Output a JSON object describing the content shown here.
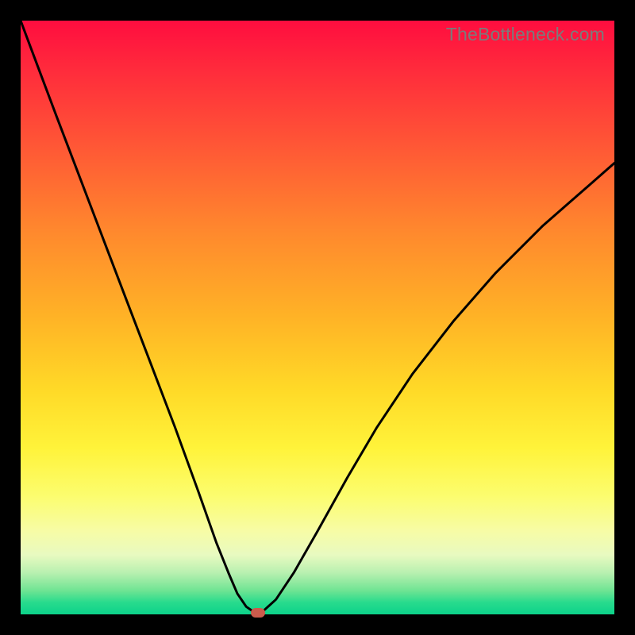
{
  "watermark_text": "TheBottleneck.com",
  "colors": {
    "frame_bg": "#000000",
    "curve_stroke": "#000000",
    "marker_fill": "#cb5b4c",
    "gradient_top": "#ff0d3f",
    "gradient_bottom": "#0cd28a"
  },
  "chart_data": {
    "type": "line",
    "title": "",
    "xlabel": "",
    "ylabel": "",
    "xlim": [
      0,
      100
    ],
    "ylim": [
      0,
      100
    ],
    "grid": false,
    "note": "Values are read off the plot as percentages of the visible axes; no numeric axis ticks are shown in the image. y≈0 is the green floor, y≈100 is the red top.",
    "series": [
      {
        "name": "curve",
        "x": [
          0,
          3,
          6,
          10,
          14,
          18,
          22,
          26,
          30,
          33,
          35,
          36.5,
          38,
          39,
          40,
          41,
          43,
          46,
          50,
          55,
          60,
          66,
          73,
          80,
          88,
          96,
          100
        ],
        "y": [
          100,
          92,
          84,
          73.5,
          63,
          52.5,
          42,
          31.5,
          20.5,
          12,
          7,
          3.5,
          1.3,
          0.6,
          0.3,
          0.7,
          2.5,
          7,
          14,
          23,
          31.5,
          40.5,
          49.5,
          57.5,
          65.5,
          72.5,
          76
        ]
      }
    ],
    "marker": {
      "x": 40,
      "y": 0.3
    },
    "background_gradient_meaning": "vertical score gradient: red=bad (top), green=good (bottom)"
  }
}
